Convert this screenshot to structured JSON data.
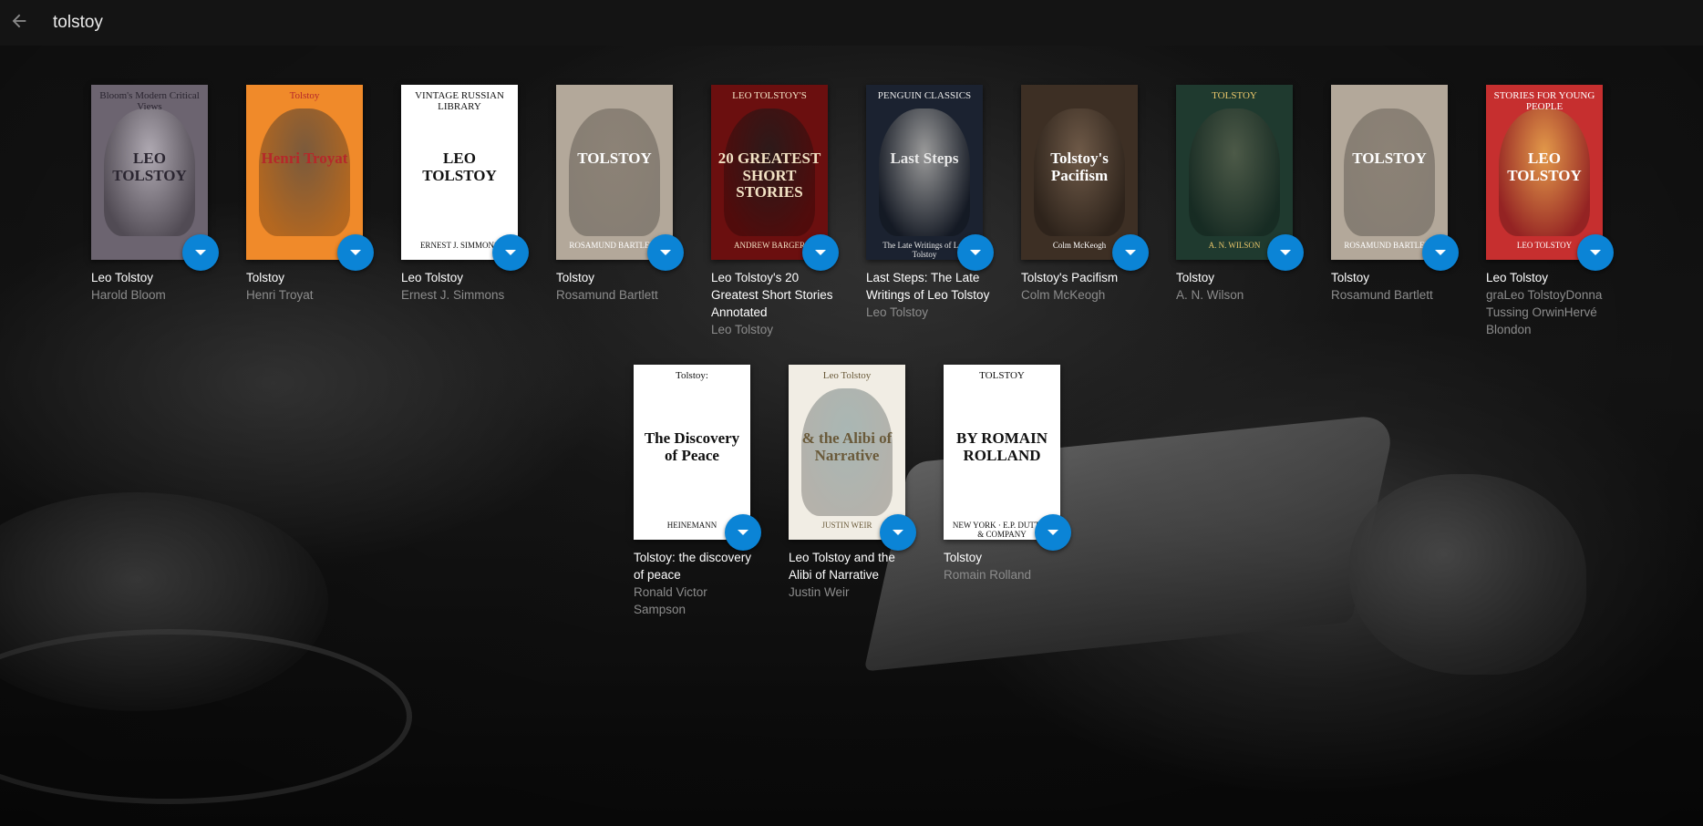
{
  "search": {
    "query": "tolstoy"
  },
  "books": [
    {
      "title": "Leo Tolstoy",
      "author": "Harold Bloom",
      "cover": {
        "bg": "#6c6470",
        "frame": "#bdb6c0",
        "top": "Bloom's Modern Critical Views",
        "main": "LEO TOLSTOY",
        "bottom": "",
        "text_color": "#2a2530",
        "portrait": "#b0aab3"
      }
    },
    {
      "title": "Tolstoy",
      "author": "Henri Troyat",
      "cover": {
        "bg": "#f08a2a",
        "frame": "#ffffff",
        "top": "Tolstoy",
        "main": "Henri Troyat",
        "bottom": "",
        "text_color": "#b5282a",
        "portrait": "#7a5a3c"
      }
    },
    {
      "title": "Leo Tolstoy",
      "author": "Ernest J. Simmons",
      "cover": {
        "bg": "#ffffff",
        "frame": "#ffffff",
        "top": "VINTAGE RUSSIAN LIBRARY",
        "main": "LEO TOLSTOY",
        "bottom": "ERNEST J. SIMMONS",
        "text_color": "#111111",
        "portrait": ""
      }
    },
    {
      "title": "Tolstoy",
      "author": "Rosamund Bartlett",
      "cover": {
        "bg": "#b3a89a",
        "frame": "#b3a89a",
        "top": "",
        "main": "TOLSTOY",
        "bottom": "ROSAMUND BARTLETT",
        "text_color": "#ffffff",
        "portrait": "#8c8276"
      }
    },
    {
      "title": "Leo Tolstoy's 20 Greatest Short Stories Annotated",
      "author": "Leo Tolstoy",
      "cover": {
        "bg": "#6b0f0f",
        "frame": "#6b0f0f",
        "top": "LEO TOLSTOY'S",
        "main": "20 GREATEST SHORT STORIES",
        "bottom": "ANDREW BARGER",
        "text_color": "#f2e2c4",
        "portrait": "#2c1a1a"
      }
    },
    {
      "title": "Last Steps: The Late Writings of Leo Tolstoy",
      "author": "Leo Tolstoy",
      "cover": {
        "bg": "#1b2230",
        "frame": "#d8d8d8",
        "top": "PENGUIN CLASSICS",
        "main": "Last Steps",
        "bottom": "The Late Writings of Leo Tolstoy",
        "text_color": "#e8e8e8",
        "portrait": "#9a9a9a"
      }
    },
    {
      "title": "Tolstoy's Pacifism",
      "author": "Colm McKeogh",
      "cover": {
        "bg": "#3d2f24",
        "frame": "#3d2f24",
        "top": "",
        "main": "Tolstoy's Pacifism",
        "bottom": "Colm McKeogh",
        "text_color": "#ffffff",
        "portrait": "#6f5a48"
      }
    },
    {
      "title": "Tolstoy",
      "author": "A. N. Wilson",
      "cover": {
        "bg": "#1f3a2f",
        "frame": "#1f3a2f",
        "top": "TOLSTOY",
        "main": "",
        "bottom": "A. N. WILSON",
        "text_color": "#e9c66a",
        "portrait": "#4d5a48"
      }
    },
    {
      "title": "Tolstoy",
      "author": "Rosamund Bartlett",
      "cover": {
        "bg": "#b3a89a",
        "frame": "#b3a89a",
        "top": "",
        "main": "TOLSTOY",
        "bottom": "ROSAMUND BARTLETT",
        "text_color": "#ffffff",
        "portrait": "#8c8276"
      }
    },
    {
      "title": "Leo Tolstoy",
      "author": "graLeo TolstoyDonna Tussing OrwinHervé Blondon",
      "cover": {
        "bg": "#c62f2f",
        "frame": "#c62f2f",
        "top": "STORIES FOR YOUNG PEOPLE",
        "main": "LEO TOLSTOY",
        "bottom": "LEO TOLSTOY",
        "text_color": "#ffffff",
        "portrait": "#e39a4a"
      }
    },
    {
      "title": "Tolstoy: the discovery of peace",
      "author": "Ronald Victor Sampson",
      "cover": {
        "bg": "#ffffff",
        "frame": "#ffffff",
        "top": "Tolstoy:",
        "main": "The Discovery of Peace",
        "bottom": "HEINEMANN",
        "text_color": "#111111",
        "portrait": ""
      }
    },
    {
      "title": "Leo Tolstoy and the Alibi of Narrative",
      "author": "Justin Weir",
      "cover": {
        "bg": "#f1ede4",
        "frame": "#f1ede4",
        "top": "Leo Tolstoy",
        "main": "& the Alibi of Narrative",
        "bottom": "JUSTIN WEIR",
        "text_color": "#6a5a3a",
        "portrait": "#a9b7b4"
      }
    },
    {
      "title": "Tolstoy",
      "author": "Romain Rolland",
      "cover": {
        "bg": "#ffffff",
        "frame": "#ffffff",
        "top": "TOLSTOY",
        "main": "BY ROMAIN ROLLAND",
        "bottom": "NEW YORK · E.P. DUTTON & COMPANY",
        "text_color": "#111111",
        "portrait": ""
      }
    }
  ],
  "colors": {
    "accent": "#0b84d6",
    "topbar": "#141414",
    "title": "#ffffff",
    "author": "#8c8c8c"
  },
  "icons": {
    "back": "arrow-left-icon",
    "menu": "dropdown-caret-icon"
  }
}
